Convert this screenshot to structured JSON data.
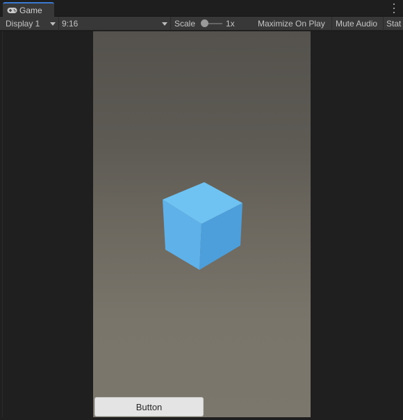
{
  "tab": {
    "label": "Game",
    "icon": "gamepad-icon",
    "accent": "#3a79d4"
  },
  "toolbar": {
    "display": "Display 1",
    "aspect": "9:16",
    "scale_label": "Scale",
    "scale_value": "1x",
    "maximize_on_play": "Maximize On Play",
    "mute_audio": "Mute Audio",
    "stats": "Stat"
  },
  "game": {
    "button_label": "Button",
    "cube_color": "#5fb3ea",
    "background_top": "#55524d",
    "background_bottom": "#7b776d"
  }
}
